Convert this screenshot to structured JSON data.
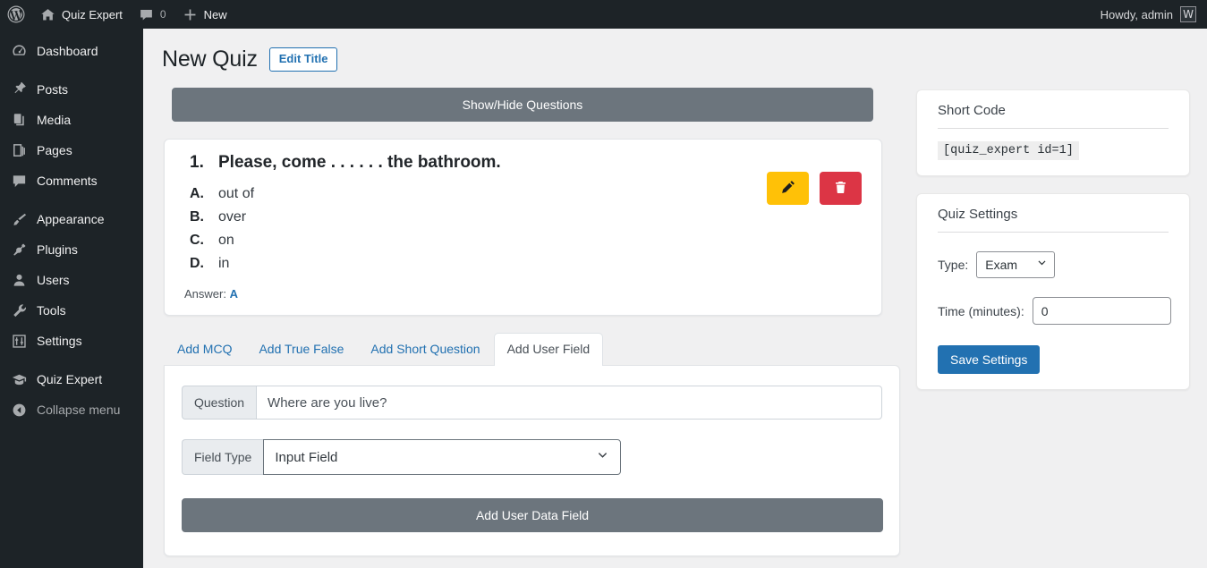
{
  "adminbar": {
    "logo_icon": "wordpress-logo-icon",
    "site_name": "Quiz Expert",
    "site_icon": "home-icon",
    "comments_icon": "comment-bubble-icon",
    "comments_count": "0",
    "new_icon": "plus-icon",
    "new_label": "New",
    "howdy": "Howdy, admin",
    "avatar_glyph": "W"
  },
  "sidebar": {
    "items": [
      {
        "label": "Dashboard",
        "icon": "dashboard-icon"
      },
      {
        "label": "Posts",
        "icon": "pin-icon"
      },
      {
        "label": "Media",
        "icon": "media-icon"
      },
      {
        "label": "Pages",
        "icon": "pages-icon"
      },
      {
        "label": "Comments",
        "icon": "comment-bubble-icon"
      },
      {
        "label": "Appearance",
        "icon": "paintbrush-icon"
      },
      {
        "label": "Plugins",
        "icon": "plug-icon"
      },
      {
        "label": "Users",
        "icon": "user-icon"
      },
      {
        "label": "Tools",
        "icon": "wrench-icon"
      },
      {
        "label": "Settings",
        "icon": "sliders-icon"
      },
      {
        "label": "Quiz Expert",
        "icon": "graduation-cap-icon"
      },
      {
        "label": "Collapse menu",
        "icon": "collapse-arrow-icon"
      }
    ]
  },
  "page": {
    "title": "New Quiz",
    "edit_title_button": "Edit Title",
    "show_hide_button": "Show/Hide Questions"
  },
  "question": {
    "number": "1.",
    "text": "Please, come . . . . . . the bathroom.",
    "options": [
      {
        "key": "A.",
        "value": "out of"
      },
      {
        "key": "B.",
        "value": "over"
      },
      {
        "key": "C.",
        "value": "on"
      },
      {
        "key": "D.",
        "value": "in"
      }
    ],
    "answer_label": "Answer:",
    "answer_value": "A",
    "edit_icon": "pencil-icon",
    "delete_icon": "trash-icon"
  },
  "tabs": [
    {
      "label": "Add MCQ",
      "active": false
    },
    {
      "label": "Add True False",
      "active": false
    },
    {
      "label": "Add Short Question",
      "active": false
    },
    {
      "label": "Add User Field",
      "active": true
    }
  ],
  "form": {
    "question_addon": "Question",
    "question_value": "Where are you live?",
    "question_placeholder": "Where are you live?",
    "fieldtype_addon": "Field Type",
    "fieldtype_value": "Input Field",
    "fieldtype_options": [
      "Input Field"
    ],
    "chevron_icon": "chevron-down-icon",
    "submit_label": "Add User Data Field"
  },
  "shortcode_panel": {
    "title": "Short Code",
    "code": "[quiz_expert id=1]"
  },
  "settings_panel": {
    "title": "Quiz Settings",
    "type_label": "Type:",
    "type_value": "Exam",
    "type_options": [
      "Exam"
    ],
    "time_label": "Time (minutes):",
    "time_value": "0",
    "save_label": "Save Settings",
    "chevron_icon": "chevron-down-icon"
  },
  "colors": {
    "admin_dark": "#1d2327",
    "wp_blue": "#2271b1",
    "secondary_gray": "#6c757d",
    "warning_yellow": "#ffc107",
    "danger_red": "#dc3545",
    "page_bg": "#f0f0f1"
  }
}
